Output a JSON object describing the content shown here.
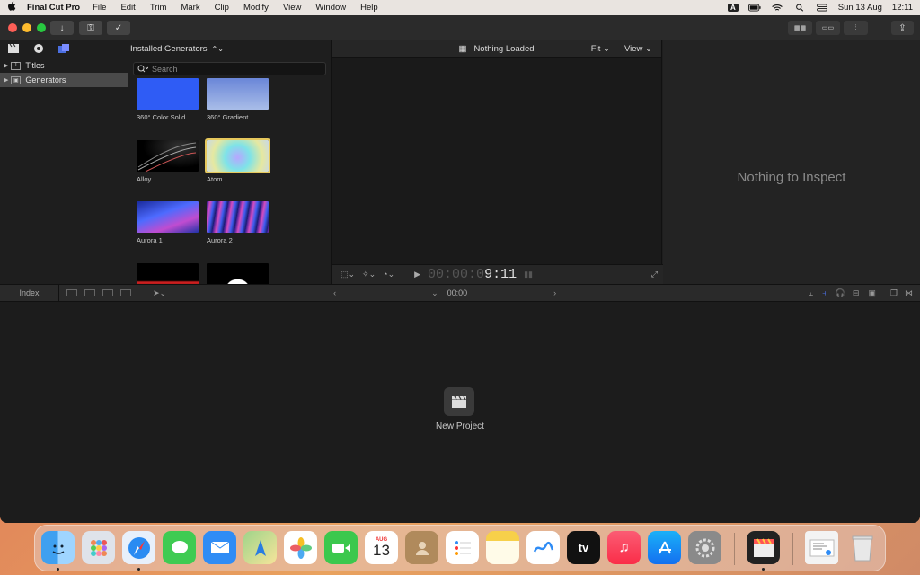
{
  "menubar": {
    "app_name": "Final Cut Pro",
    "items": [
      "File",
      "Edit",
      "Trim",
      "Mark",
      "Clip",
      "Modify",
      "View",
      "Window",
      "Help"
    ],
    "input_badge": "A",
    "date": "Sun 13 Aug",
    "time": "12:11"
  },
  "browser": {
    "sidebar": [
      {
        "label": "Titles",
        "selected": false
      },
      {
        "label": "Generators",
        "selected": true
      }
    ],
    "header": "Installed Generators",
    "search_placeholder": "Search",
    "generators": [
      {
        "label": "360° Color Solid"
      },
      {
        "label": "360° Gradient"
      },
      {
        "label": "Alloy"
      },
      {
        "label": "Atom",
        "selected": true
      },
      {
        "label": "Aurora 1"
      },
      {
        "label": "Aurora 2"
      },
      {
        "label": ""
      },
      {
        "label": ""
      }
    ]
  },
  "viewer": {
    "title": "Nothing Loaded",
    "fit_label": "Fit",
    "view_label": "View",
    "timecode_dim": "00:00:0",
    "timecode_bright": "9:11"
  },
  "inspector": {
    "message": "Nothing to Inspect"
  },
  "timeline": {
    "index_label": "Index",
    "timecode": "00:00",
    "new_project_label": "New Project"
  },
  "dock": {
    "calendar_month": "AUG",
    "calendar_day": "13",
    "tv_label": "tv"
  },
  "colors": {
    "accent_selection": "#e5c75c",
    "traffic_red": "#fe5f57",
    "traffic_yellow": "#febc2e",
    "traffic_green": "#28c840"
  }
}
